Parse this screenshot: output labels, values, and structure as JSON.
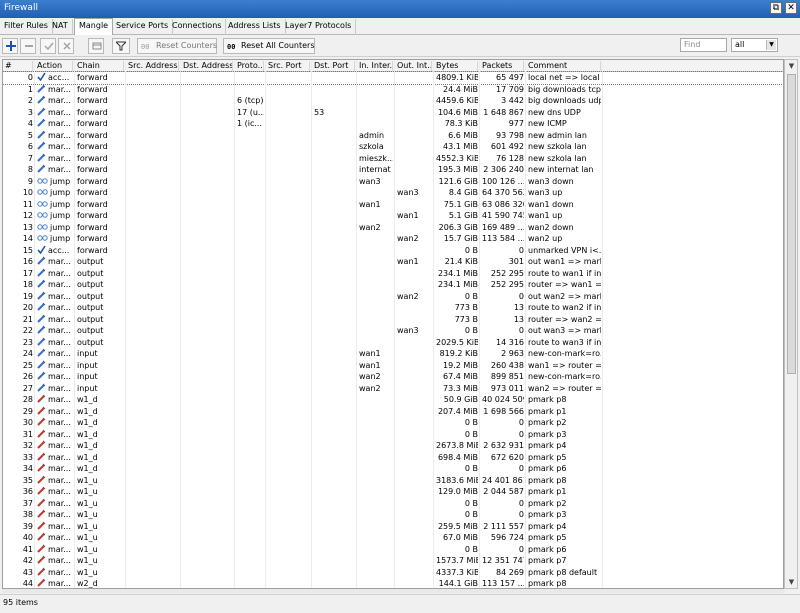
{
  "window": {
    "title": "Firewall",
    "restore_label": "⧉",
    "close_label": "✕"
  },
  "tabs": [
    "Filter Rules",
    "NAT",
    "Mangle",
    "Service Ports",
    "Connections",
    "Address Lists",
    "Layer7 Protocols"
  ],
  "active_tab": "Mangle",
  "toolbar": {
    "reset_counters_label": "Reset Counters",
    "reset_all_counters_label": "Reset All Counters",
    "find_placeholder": "Find",
    "filter_value": "all",
    "dropdown_arrow": "▼"
  },
  "columns": [
    "#",
    "Action",
    "Chain",
    "Src. Address",
    "Dst. Address",
    "Proto...",
    "Src. Port",
    "Dst. Port",
    "In. Inter...",
    "Out. Int...",
    "Bytes",
    "Packets",
    "Comment"
  ],
  "scroll": {
    "up": "▲",
    "down": "▼"
  },
  "colors": {
    "mark": "#2f6fd0",
    "accept": "#1d55b4",
    "jump": "#4a7fc9",
    "title_bar": "#2a6cc4"
  },
  "rows": [
    {
      "num": "0",
      "icon": "accept",
      "action": "acc...",
      "chain": "forward",
      "proto": "",
      "dport": "",
      "in": "",
      "out": "",
      "bytes": "4809.1 KiB",
      "packets": "65 497",
      "comment": "local net => local ..."
    },
    {
      "num": "1",
      "icon": "mark",
      "action": "mar...",
      "chain": "forward",
      "proto": "",
      "dport": "",
      "in": "",
      "out": "",
      "bytes": "24.4 MiB",
      "packets": "17 709",
      "comment": "big downloads tcp"
    },
    {
      "num": "2",
      "icon": "mark",
      "action": "mar...",
      "chain": "forward",
      "proto": "6 (tcp)",
      "dport": "",
      "in": "",
      "out": "",
      "bytes": "4459.6 KiB",
      "packets": "3 442",
      "comment": "big downloads udp"
    },
    {
      "num": "3",
      "icon": "mark",
      "action": "mar...",
      "chain": "forward",
      "proto": "17 (u...",
      "dport": "53",
      "in": "",
      "out": "",
      "bytes": "104.6 MiB",
      "packets": "1 648 867",
      "comment": "new dns UDP"
    },
    {
      "num": "4",
      "icon": "mark",
      "action": "mar...",
      "chain": "forward",
      "proto": "1 (ic...",
      "dport": "",
      "in": "",
      "out": "",
      "bytes": "78.3 KiB",
      "packets": "977",
      "comment": "new ICMP"
    },
    {
      "num": "5",
      "icon": "mark",
      "action": "mar...",
      "chain": "forward",
      "proto": "",
      "dport": "",
      "in": "admin",
      "out": "",
      "bytes": "6.6 MiB",
      "packets": "93 798",
      "comment": "new admin lan"
    },
    {
      "num": "6",
      "icon": "mark",
      "action": "mar...",
      "chain": "forward",
      "proto": "",
      "dport": "",
      "in": "szkola",
      "out": "",
      "bytes": "43.1 MiB",
      "packets": "601 492",
      "comment": "new szkola lan"
    },
    {
      "num": "7",
      "icon": "mark",
      "action": "mar...",
      "chain": "forward",
      "proto": "",
      "dport": "",
      "in": "mieszk...",
      "out": "",
      "bytes": "4552.3 KiB",
      "packets": "76 128",
      "comment": "new szkola lan"
    },
    {
      "num": "8",
      "icon": "mark",
      "action": "mar...",
      "chain": "forward",
      "proto": "",
      "dport": "",
      "in": "internat",
      "out": "",
      "bytes": "195.3 MiB",
      "packets": "2 306 240",
      "comment": "new internat lan"
    },
    {
      "num": "9",
      "icon": "jump",
      "action": "jump",
      "chain": "forward",
      "proto": "",
      "dport": "",
      "in": "wan3",
      "out": "",
      "bytes": "121.6 GiB",
      "packets": "100 126 ...",
      "comment": "wan3 down"
    },
    {
      "num": "10",
      "icon": "jump",
      "action": "jump",
      "chain": "forward",
      "proto": "",
      "dport": "",
      "in": "",
      "out": "wan3",
      "bytes": "8.4 GiB",
      "packets": "64 370 563",
      "comment": "wan3 up"
    },
    {
      "num": "11",
      "icon": "jump",
      "action": "jump",
      "chain": "forward",
      "proto": "",
      "dport": "",
      "in": "wan1",
      "out": "",
      "bytes": "75.1 GiB",
      "packets": "63 086 320",
      "comment": "wan1 down"
    },
    {
      "num": "12",
      "icon": "jump",
      "action": "jump",
      "chain": "forward",
      "proto": "",
      "dport": "",
      "in": "",
      "out": "wan1",
      "bytes": "5.1 GiB",
      "packets": "41 590 745",
      "comment": "wan1 up"
    },
    {
      "num": "13",
      "icon": "jump",
      "action": "jump",
      "chain": "forward",
      "proto": "",
      "dport": "",
      "in": "wan2",
      "out": "",
      "bytes": "206.3 GiB",
      "packets": "169 489 ...",
      "comment": "wan2 down"
    },
    {
      "num": "14",
      "icon": "jump",
      "action": "jump",
      "chain": "forward",
      "proto": "",
      "dport": "",
      "in": "",
      "out": "wan2",
      "bytes": "15.7 GiB",
      "packets": "113 584 ...",
      "comment": "wan2 up"
    },
    {
      "num": "15",
      "icon": "accept",
      "action": "acc...",
      "chain": "forward",
      "proto": "",
      "dport": "",
      "in": "",
      "out": "",
      "bytes": "0 B",
      "packets": "0",
      "comment": "unmarked VPN i<..."
    },
    {
      "num": "16",
      "icon": "mark",
      "action": "mar...",
      "chain": "output",
      "proto": "",
      "dport": "",
      "in": "",
      "out": "wan1",
      "bytes": "21.4 KiB",
      "packets": "301",
      "comment": "out wan1 => mark..."
    },
    {
      "num": "17",
      "icon": "mark",
      "action": "mar...",
      "chain": "output",
      "proto": "",
      "dport": "",
      "in": "",
      "out": "",
      "bytes": "234.1 MiB",
      "packets": "252 295",
      "comment": "route to wan1 if in..."
    },
    {
      "num": "18",
      "icon": "mark",
      "action": "mar...",
      "chain": "output",
      "proto": "",
      "dport": "",
      "in": "",
      "out": "",
      "bytes": "234.1 MiB",
      "packets": "252 295",
      "comment": "router => wan1 =..."
    },
    {
      "num": "19",
      "icon": "mark",
      "action": "mar...",
      "chain": "output",
      "proto": "",
      "dport": "",
      "in": "",
      "out": "wan2",
      "bytes": "0 B",
      "packets": "0",
      "comment": "out wan2 => mark..."
    },
    {
      "num": "20",
      "icon": "mark",
      "action": "mar...",
      "chain": "output",
      "proto": "",
      "dport": "",
      "in": "",
      "out": "",
      "bytes": "773 B",
      "packets": "13",
      "comment": "route to wan2 if in..."
    },
    {
      "num": "21",
      "icon": "mark",
      "action": "mar...",
      "chain": "output",
      "proto": "",
      "dport": "",
      "in": "",
      "out": "",
      "bytes": "773 B",
      "packets": "13",
      "comment": "router => wan2 =>..."
    },
    {
      "num": "22",
      "icon": "mark",
      "action": "mar...",
      "chain": "output",
      "proto": "",
      "dport": "",
      "in": "",
      "out": "wan3",
      "bytes": "0 B",
      "packets": "0",
      "comment": "out wan3 => mark..."
    },
    {
      "num": "23",
      "icon": "mark",
      "action": "mar...",
      "chain": "output",
      "proto": "",
      "dport": "",
      "in": "",
      "out": "",
      "bytes": "2029.5 KiB",
      "packets": "14 316",
      "comment": "route to wan3 if in..."
    },
    {
      "num": "24",
      "icon": "mark",
      "action": "mar...",
      "chain": "input",
      "proto": "",
      "dport": "",
      "in": "wan1",
      "out": "",
      "bytes": "819.2 KiB",
      "packets": "2 963",
      "comment": "new-con-mark=ro..."
    },
    {
      "num": "25",
      "icon": "mark",
      "action": "mar...",
      "chain": "input",
      "proto": "",
      "dport": "",
      "in": "wan1",
      "out": "",
      "bytes": "19.2 MiB",
      "packets": "260 438",
      "comment": "wan1 => router =>..."
    },
    {
      "num": "26",
      "icon": "mark",
      "action": "mar...",
      "chain": "input",
      "proto": "",
      "dport": "",
      "in": "wan2",
      "out": "",
      "bytes": "67.4 MiB",
      "packets": "899 851",
      "comment": "new-con-mark=ro..."
    },
    {
      "num": "27",
      "icon": "mark",
      "action": "mar...",
      "chain": "input",
      "proto": "",
      "dport": "",
      "in": "wan2",
      "out": "",
      "bytes": "73.3 MiB",
      "packets": "973 011",
      "comment": "wan2 => router =>..."
    },
    {
      "num": "28",
      "icon": "mark2",
      "action": "mar...",
      "chain": "w1_d",
      "proto": "",
      "dport": "",
      "in": "",
      "out": "",
      "bytes": "50.9 GiB",
      "packets": "40 024 509",
      "comment": "pmark p8"
    },
    {
      "num": "29",
      "icon": "mark2",
      "action": "mar...",
      "chain": "w1_d",
      "proto": "",
      "dport": "",
      "in": "",
      "out": "",
      "bytes": "207.4 MiB",
      "packets": "1 698 566",
      "comment": "pmark p1"
    },
    {
      "num": "30",
      "icon": "mark2",
      "action": "mar...",
      "chain": "w1_d",
      "proto": "",
      "dport": "",
      "in": "",
      "out": "",
      "bytes": "0 B",
      "packets": "0",
      "comment": "pmark p2"
    },
    {
      "num": "31",
      "icon": "mark2",
      "action": "mar...",
      "chain": "w1_d",
      "proto": "",
      "dport": "",
      "in": "",
      "out": "",
      "bytes": "0 B",
      "packets": "0",
      "comment": "pmark p3"
    },
    {
      "num": "32",
      "icon": "mark2",
      "action": "mar...",
      "chain": "w1_d",
      "proto": "",
      "dport": "",
      "in": "",
      "out": "",
      "bytes": "2673.8 MiB",
      "packets": "2 632 931",
      "comment": "pmark p4"
    },
    {
      "num": "33",
      "icon": "mark2",
      "action": "mar...",
      "chain": "w1_d",
      "proto": "",
      "dport": "",
      "in": "",
      "out": "",
      "bytes": "698.4 MiB",
      "packets": "672 620",
      "comment": "pmark p5"
    },
    {
      "num": "34",
      "icon": "mark2",
      "action": "mar...",
      "chain": "w1_d",
      "proto": "",
      "dport": "",
      "in": "",
      "out": "",
      "bytes": "0 B",
      "packets": "0",
      "comment": "pmark p6"
    },
    {
      "num": "35",
      "icon": "mark2",
      "action": "mar...",
      "chain": "w1_u",
      "proto": "",
      "dport": "",
      "in": "",
      "out": "",
      "bytes": "3183.6 MiB",
      "packets": "24 401 861",
      "comment": "pmark p8"
    },
    {
      "num": "36",
      "icon": "mark2",
      "action": "mar...",
      "chain": "w1_u",
      "proto": "",
      "dport": "",
      "in": "",
      "out": "",
      "bytes": "129.0 MiB",
      "packets": "2 044 587",
      "comment": "pmark p1"
    },
    {
      "num": "37",
      "icon": "mark2",
      "action": "mar...",
      "chain": "w1_u",
      "proto": "",
      "dport": "",
      "in": "",
      "out": "",
      "bytes": "0 B",
      "packets": "0",
      "comment": "pmark p2"
    },
    {
      "num": "38",
      "icon": "mark2",
      "action": "mar...",
      "chain": "w1_u",
      "proto": "",
      "dport": "",
      "in": "",
      "out": "",
      "bytes": "0 B",
      "packets": "0",
      "comment": "pmark p3"
    },
    {
      "num": "39",
      "icon": "mark2",
      "action": "mar...",
      "chain": "w1_u",
      "proto": "",
      "dport": "",
      "in": "",
      "out": "",
      "bytes": "259.5 MiB",
      "packets": "2 111 557",
      "comment": "pmark p4"
    },
    {
      "num": "40",
      "icon": "mark2",
      "action": "mar...",
      "chain": "w1_u",
      "proto": "",
      "dport": "",
      "in": "",
      "out": "",
      "bytes": "67.0 MiB",
      "packets": "596 724",
      "comment": "pmark p5"
    },
    {
      "num": "41",
      "icon": "mark2",
      "action": "mar...",
      "chain": "w1_u",
      "proto": "",
      "dport": "",
      "in": "",
      "out": "",
      "bytes": "0 B",
      "packets": "0",
      "comment": "pmark p6"
    },
    {
      "num": "42",
      "icon": "mark2",
      "action": "mar...",
      "chain": "w1_u",
      "proto": "",
      "dport": "",
      "in": "",
      "out": "",
      "bytes": "1573.7 MiB",
      "packets": "12 351 747",
      "comment": "pmark p7"
    },
    {
      "num": "43",
      "icon": "mark2",
      "action": "mar...",
      "chain": "w1_u",
      "proto": "",
      "dport": "",
      "in": "",
      "out": "",
      "bytes": "4337.3 KiB",
      "packets": "84 269",
      "comment": "pmark p8 default"
    },
    {
      "num": "44",
      "icon": "mark2",
      "action": "mar...",
      "chain": "w2_d",
      "proto": "",
      "dport": "",
      "in": "",
      "out": "",
      "bytes": "144.1 GiB",
      "packets": "113 157 ...",
      "comment": "pmark p8"
    }
  ],
  "status": {
    "items_count": "95 items"
  }
}
